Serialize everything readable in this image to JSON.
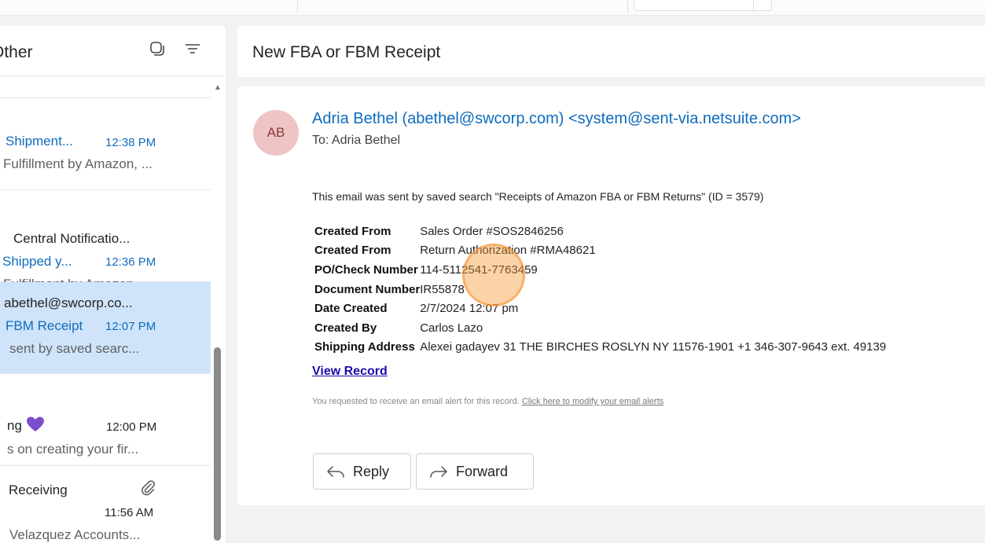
{
  "colors": {
    "accent": "#0f6cbd",
    "selected": "#cfe4fa",
    "avatar_bg": "#efc4c4",
    "click_marker": "#f59632",
    "heart": "#7c4dcc"
  },
  "list": {
    "folder_name": "Other",
    "icons": [
      "select-mode-icon",
      "filter-icon"
    ],
    "items": [
      {
        "subject": "Shipment...",
        "time": "12:38 PM",
        "preview": "Fulfillment by Amazon, ..."
      },
      {
        "sender": "Central Notificatio...",
        "subject": "Shipped y...",
        "time": "12:36 PM",
        "preview": "Fulfillment by Amazon, ..."
      },
      {
        "sender": "abethel@swcorp.co...",
        "subject": "FBM Receipt",
        "time": "12:07 PM",
        "preview": "sent by saved searc..."
      },
      {
        "sender": "ng",
        "time": "12:00 PM",
        "preview": "s on creating your fir..."
      },
      {
        "sender": "Receiving",
        "time": "11:56 AM",
        "preview": "Velazquez Accounts..."
      }
    ]
  },
  "reading": {
    "subject": "New FBA or FBM Receipt",
    "avatar_initials": "AB",
    "from": "Adria Bethel (abethel@swcorp.com) <system@sent-via.netsuite.com>",
    "to": "To:  Adria Bethel",
    "intro": "This email was sent by saved search \"Receipts of Amazon FBA or FBM Returns\" (ID = 3579)",
    "fields": [
      {
        "label": "Created From",
        "value": "Sales Order #SOS2846256"
      },
      {
        "label": "Created From",
        "value": "Return Authorization #RMA48621"
      },
      {
        "label": "PO/Check Number",
        "value": "114-5112541-7763459"
      },
      {
        "label": "Document Number",
        "value": "IR55878"
      },
      {
        "label": "Date Created",
        "value": "2/7/2024 12:07 pm"
      },
      {
        "label": "Created By",
        "value": "Carlos Lazo"
      },
      {
        "label": "Shipping Address",
        "value": "Alexei gadayev 31 THE BIRCHES ROSLYN NY 11576-1901 +1 346-307-9643 ext. 49139"
      }
    ],
    "view_record": "View Record",
    "alert_text": "You requested to receive an email alert for this record.",
    "alert_link": "Click here to modify your email alerts",
    "reply_label": "Reply",
    "forward_label": "Forward"
  }
}
